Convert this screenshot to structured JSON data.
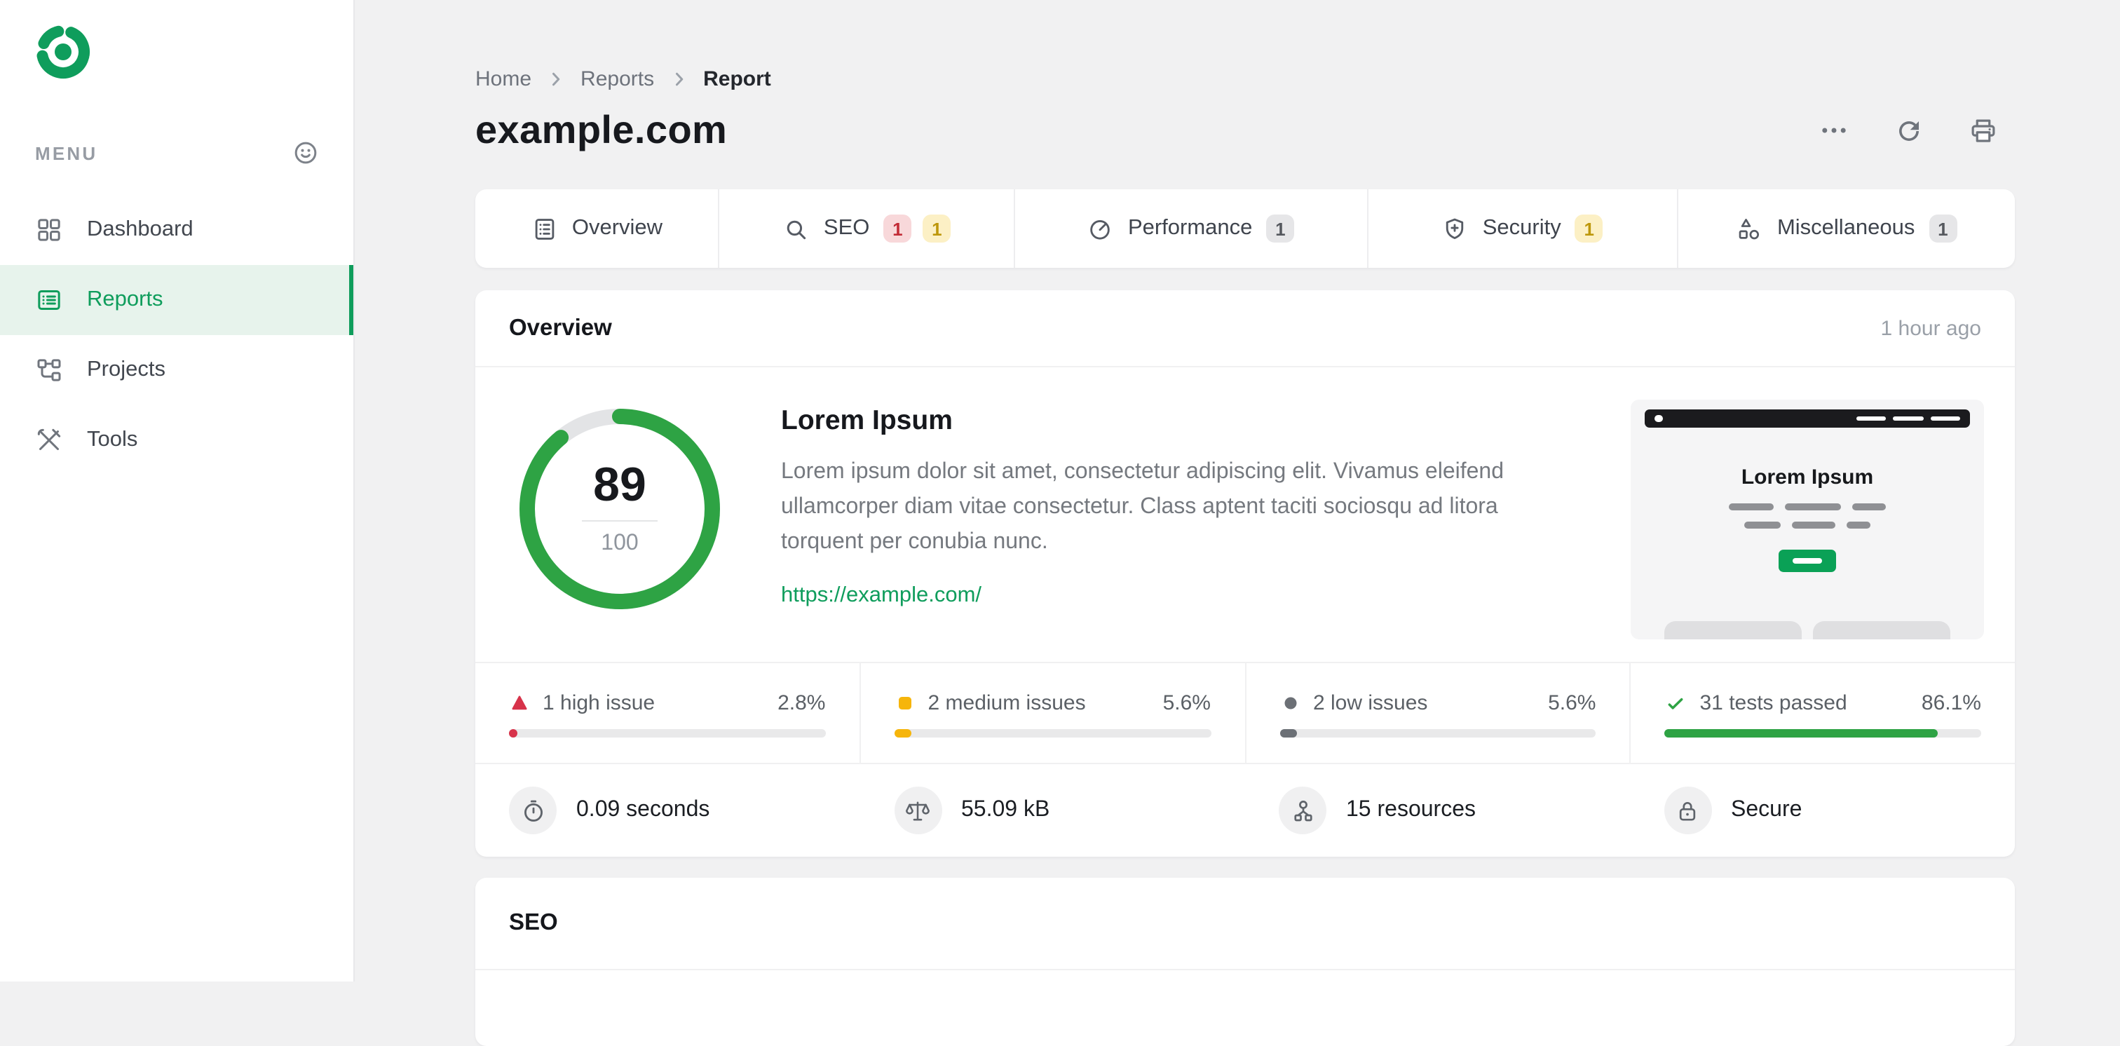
{
  "sidebar": {
    "menu_label": "MENU",
    "items": [
      {
        "label": "Dashboard"
      },
      {
        "label": "Reports"
      },
      {
        "label": "Projects"
      },
      {
        "label": "Tools"
      }
    ]
  },
  "header": {
    "breadcrumb": {
      "home": "Home",
      "section": "Reports",
      "current": "Report"
    },
    "title": "example.com"
  },
  "tabs": [
    {
      "label": "Overview",
      "badges": []
    },
    {
      "label": "SEO",
      "badges": [
        {
          "value": "1",
          "type": "high"
        },
        {
          "value": "1",
          "type": "medium"
        }
      ]
    },
    {
      "label": "Performance",
      "badges": [
        {
          "value": "1",
          "type": "neutral"
        }
      ]
    },
    {
      "label": "Security",
      "badges": [
        {
          "value": "1",
          "type": "medium"
        }
      ]
    },
    {
      "label": "Miscellaneous",
      "badges": [
        {
          "value": "1",
          "type": "neutral"
        }
      ]
    }
  ],
  "overview": {
    "section_title": "Overview",
    "timestamp": "1 hour ago",
    "gauge": {
      "score": 89,
      "max": 100
    },
    "summary": {
      "title": "Lorem Ipsum",
      "description": "Lorem ipsum dolor sit amet, consectetur adipiscing elit. Vivamus eleifend ullamcorper diam vitae consectetur. Class aptent taciti sociosqu ad litora torquent per conubia nunc.",
      "url": "https://example.com/"
    },
    "thumbnail": {
      "title": "Lorem Ipsum"
    },
    "stats": [
      {
        "label": "1 high issue",
        "percent": 2.8,
        "percent_label": "2.8%",
        "color": "#d7334a",
        "icon": "triangle-high-icon"
      },
      {
        "label": "2 medium issues",
        "percent": 5.6,
        "percent_label": "5.6%",
        "color": "#f6b50b",
        "icon": "square-medium-icon"
      },
      {
        "label": "2 low issues",
        "percent": 5.6,
        "percent_label": "5.6%",
        "color": "#6c7076",
        "icon": "circle-low-icon"
      },
      {
        "label": "31 tests passed",
        "percent": 86.1,
        "percent_label": "86.1%",
        "color": "#2ea344",
        "icon": "check-icon"
      }
    ],
    "metrics": [
      {
        "value": "0.09 seconds",
        "icon": "stopwatch-icon"
      },
      {
        "value": "55.09 kB",
        "icon": "scale-icon"
      },
      {
        "value": "15 resources",
        "icon": "resources-icon"
      },
      {
        "value": "Secure",
        "icon": "lock-icon"
      }
    ]
  },
  "seo": {
    "section_title": "SEO"
  },
  "colors": {
    "accent_green": "#0f9d5c",
    "gauge_green": "#2ea344",
    "high_red": "#d7334a",
    "medium_yellow": "#f6b50b",
    "low_gray": "#6c7076"
  }
}
